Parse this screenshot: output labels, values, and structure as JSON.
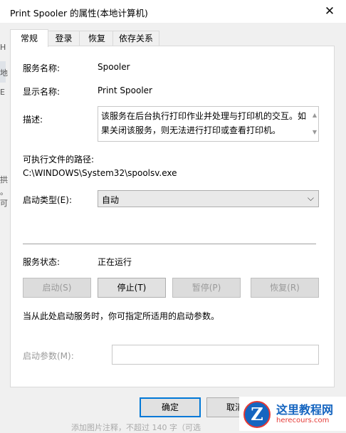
{
  "window": {
    "title": "Print Spooler 的属性(本地计算机)",
    "close_glyph": "✕"
  },
  "background_fragments": [
    "H",
    "地",
    "E",
    "拱",
    "。",
    "可",
    "添加图片注释，不超过 140 字（可选"
  ],
  "tabs": [
    {
      "label": "常规",
      "active": true
    },
    {
      "label": "登录",
      "active": false
    },
    {
      "label": "恢复",
      "active": false
    },
    {
      "label": "依存关系",
      "active": false
    }
  ],
  "general": {
    "service_name_label": "服务名称:",
    "service_name": "Spooler",
    "display_name_label": "显示名称:",
    "display_name": "Print Spooler",
    "description_label": "描述:",
    "description": "该服务在后台执行打印作业并处理与打印机的交互。如果关闭该服务，则无法进行打印或查看打印机。",
    "exe_path_label": "可执行文件的路径:",
    "exe_path": "C:\\WINDOWS\\System32\\spoolsv.exe",
    "startup_type_label": "启动类型(E):",
    "startup_type": "自动",
    "status_label": "服务状态:",
    "status": "正在运行",
    "buttons": {
      "start": "启动(S)",
      "stop": "停止(T)",
      "pause": "暂停(P)",
      "resume": "恢复(R)"
    },
    "hint": "当从此处启动服务时，你可指定所适用的启动参数。",
    "start_params_label": "启动参数(M):",
    "start_params_value": ""
  },
  "footer": {
    "ok": "确定",
    "cancel": "取消"
  },
  "watermark": {
    "site": "这里教程网",
    "url": "herecours.com",
    "logo_letter": "Z"
  },
  "colors": {
    "accent": "#0078d7",
    "panel_bg": "#ffffff",
    "dialog_bg": "#f0f0f0"
  }
}
